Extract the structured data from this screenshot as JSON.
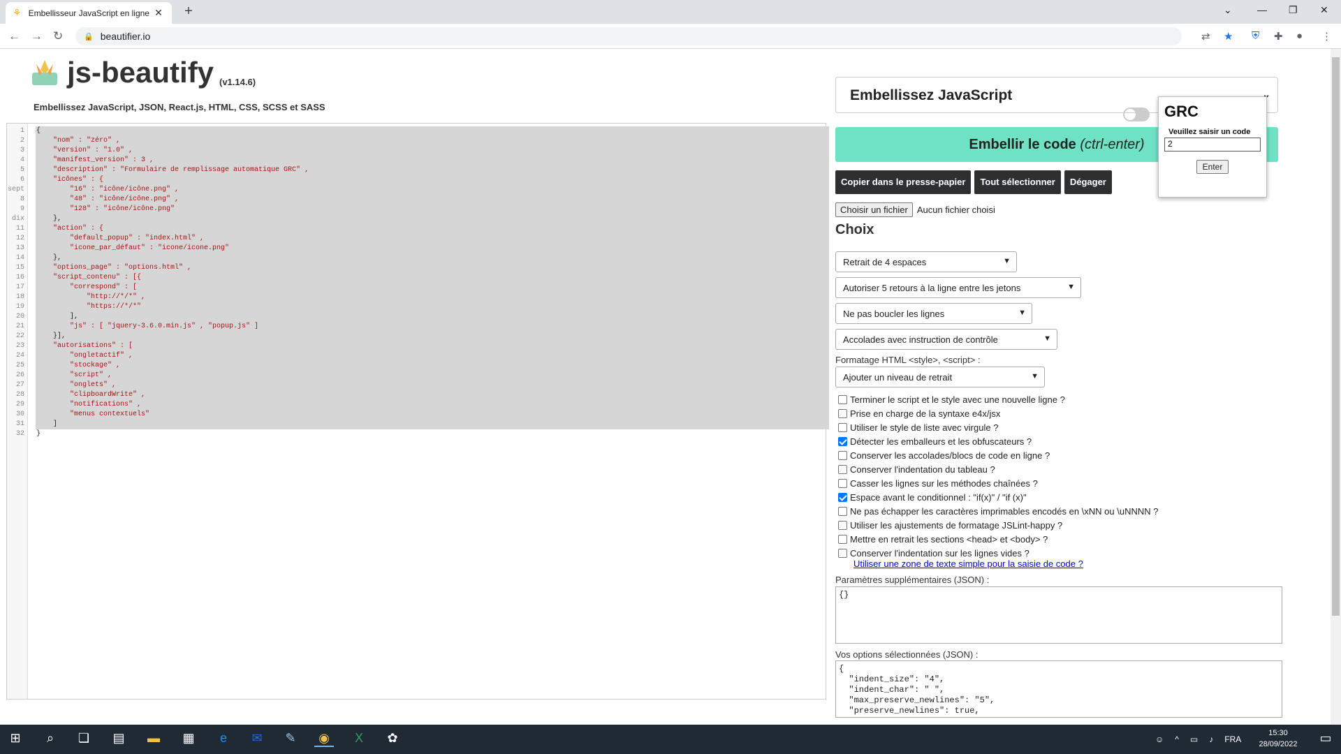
{
  "browser": {
    "tab_title": "Embellisseur JavaScript en ligne",
    "tab_close": "✕",
    "new_tab": "+",
    "url": "beautifier.io",
    "back": "←",
    "forward": "→",
    "reload": "↻"
  },
  "header": {
    "title": "js-beautify",
    "version": "(v1.14.6)",
    "subtitle": "Embellissez JavaScript, JSON, React.js, HTML, CSS, SCSS et SASS"
  },
  "editor": {
    "line_numbers": [
      "1",
      "2",
      "3",
      "4",
      "5",
      "6",
      "sept",
      "8",
      "9",
      "dix",
      "11",
      "12",
      "13",
      "14",
      "15",
      "16",
      "17",
      "18",
      "19",
      "20",
      "21",
      "22",
      "23",
      "24",
      "25",
      "26",
      "27",
      "28",
      "29",
      "30",
      "31",
      "32"
    ],
    "lines": [
      "{",
      "    \"nom\" : \"zéro\" ,",
      "    \"version\" : \"1.0\" ,",
      "    \"manifest_version\" : 3 ,",
      "    \"description\" : \"Formulaire de remplissage automatique GRC\" ,",
      "    \"icônes\" : {",
      "        \"16\" : \"icône/icône.png\" ,",
      "        \"48\" : \"icône/icône.png\" ,",
      "        \"128\" : \"icône/icône.png\"",
      "    },",
      "    \"action\" : {",
      "        \"default_popup\" : \"index.html\" ,",
      "        \"icone_par_défaut\" : \"icone/icone.png\"",
      "    },",
      "    \"options_page\" : \"options.html\" ,",
      "    \"script_contenu\" : [{",
      "        \"correspond\" : [",
      "            \"http://*/*\" ,",
      "            \"https://*/*\"",
      "        ],",
      "        \"js\" : [ \"jquery-3.6.0.min.js\" , \"popup.js\" ]",
      "    }],",
      "    \"autorisations\" : [",
      "        \"ongletactif\" ,",
      "        \"stockage\" ,",
      "        \"script\" ,",
      "        \"onglets\" ,",
      "        \"clipboardWrite\" ,",
      "        \"notifications\" ,",
      "        \"menus contextuels\"",
      "    ]",
      "}"
    ]
  },
  "panel": {
    "language_select": "Embellissez JavaScript",
    "beautify_label": "Embellir le code",
    "beautify_shortcut": "(ctrl-enter)",
    "copy_button": "Copier dans le presse-papier",
    "select_all_button": "Tout sélectionner",
    "clear_button": "Dégager",
    "file_button": "Choisir un fichier",
    "file_status": "Aucun fichier choisi",
    "options_heading": "Choix",
    "selects": {
      "indent": "Retrait de 4 espaces",
      "newlines": "Autoriser 5 retours à la ligne entre les jetons",
      "wrap": "Ne pas boucler les lignes",
      "braces": "Accolades avec instruction de contrôle",
      "html_indent": "Ajouter un niveau de retrait"
    },
    "html_format_label": "Formatage HTML <style>, <script> :",
    "checkboxes": [
      {
        "label": "Terminer le script et le style avec une nouvelle ligne ?",
        "checked": false
      },
      {
        "label": "Prise en charge de la syntaxe e4x/jsx",
        "checked": false
      },
      {
        "label": "Utiliser le style de liste avec virgule ?",
        "checked": false
      },
      {
        "label": "Détecter les emballeurs et les obfuscateurs ?",
        "checked": true
      },
      {
        "label": "Conserver les accolades/blocs de code en ligne ?",
        "checked": false
      },
      {
        "label": "Conserver l'indentation du tableau ?",
        "checked": false
      },
      {
        "label": "Casser les lignes sur les méthodes chaînées ?",
        "checked": false
      },
      {
        "label": "Espace avant le conditionnel : \"if(x)\" / \"if (x)\"",
        "checked": true
      },
      {
        "label": "Ne pas échapper les caractères imprimables encodés en \\xNN ou \\uNNNN ?",
        "checked": false
      },
      {
        "label": "Utiliser les ajustements de formatage JSLint-happy ?",
        "checked": false
      },
      {
        "label": "Mettre en retrait les sections <head> et <body> ?",
        "checked": false
      },
      {
        "label": "Conserver l'indentation sur les lignes vides ?",
        "checked": false
      }
    ],
    "textarea_link": "Utiliser une zone de texte simple pour la saisie de code ?",
    "extra_params_label": "Paramètres supplémentaires (JSON) :",
    "extra_params_value": "{}",
    "selected_options_label": "Vos options sélectionnées (JSON) :",
    "selected_options_value": "{\n  \"indent_size\": \"4\",\n  \"indent_char\": \" \",\n  \"max_preserve_newlines\": \"5\",\n  \"preserve_newlines\": true,"
  },
  "popup": {
    "title": "GRC",
    "prompt": "Veuillez saisir un code",
    "input_value": "2",
    "enter_button": "Enter"
  },
  "taskbar": {
    "language": "FRA",
    "time": "15:30",
    "date": "28/09/2022"
  }
}
